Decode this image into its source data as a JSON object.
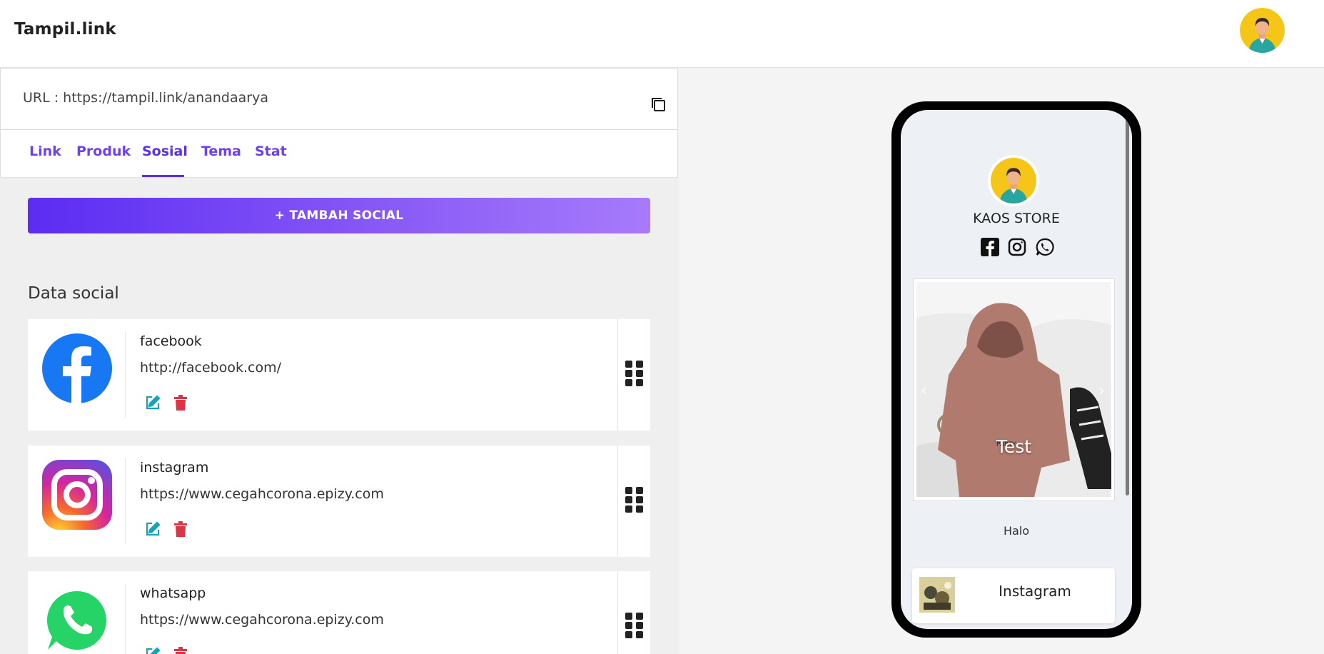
{
  "header": {
    "brand": "Tampil.link",
    "avatar_icon": "user-avatar-icon"
  },
  "editor": {
    "url_label": "URL : https://tampil.link/anandaarya",
    "copy_icon": "copy-icon",
    "tabs": [
      {
        "label": "Link",
        "active": false
      },
      {
        "label": "Produk",
        "active": false
      },
      {
        "label": "Sosial",
        "active": true
      },
      {
        "label": "Tema",
        "active": false
      },
      {
        "label": "Stat",
        "active": false
      }
    ],
    "add_button": "+ TAMBAH SOCIAL",
    "section_title": "Data social",
    "socials": [
      {
        "name": "facebook",
        "url": "http://facebook.com/",
        "icon": "facebook-icon"
      },
      {
        "name": "instagram",
        "url": "https://www.cegahcorona.epizy.com",
        "icon": "instagram-icon"
      },
      {
        "name": "whatsapp",
        "url": "https://www.cegahcorona.epizy.com",
        "icon": "whatsapp-icon"
      }
    ]
  },
  "preview": {
    "store_name": "KAOS STORE",
    "social_icons": [
      "facebook-icon",
      "instagram-icon",
      "whatsapp-icon"
    ],
    "slide_caption": "Test",
    "text": "Halo",
    "link_label": "Instagram"
  },
  "colors": {
    "accent": "#5a31e8",
    "button_gradient_start": "#5b2cf2",
    "button_gradient_end": "#a77bfb",
    "edit": "#17a2b8",
    "delete": "#dc3545"
  }
}
